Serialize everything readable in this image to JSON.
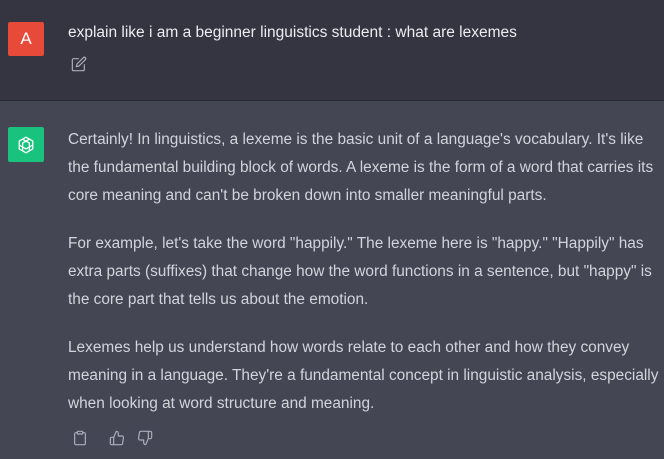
{
  "user_message": {
    "avatar_letter": "A",
    "avatar_color": "#e84a3a",
    "text": "explain like i am a beginner linguistics student : what are lexemes",
    "edit_icon": "edit-icon"
  },
  "assistant_message": {
    "avatar_icon": "openai-logo-icon",
    "avatar_color": "#19c37d",
    "paragraphs": [
      "Certainly! In linguistics, a lexeme is the basic unit of a language's vocabulary. It's like the fundamental building block of words. A lexeme is the form of a word that carries its core meaning and can't be broken down into smaller meaningful parts.",
      "For example, let's take the word \"happily.\" The lexeme here is \"happy.\" \"Happily\" has extra parts (suffixes) that change how the word functions in a sentence, but \"happy\" is the core part that tells us about the emotion.",
      "Lexemes help us understand how words relate to each other and how they convey meaning in a language. They're a fundamental concept in linguistic analysis, especially when looking at word structure and meaning."
    ],
    "actions": [
      "copy-icon",
      "thumbs-up-icon",
      "thumbs-down-icon"
    ]
  },
  "colors": {
    "user_bg": "#343541",
    "assistant_bg": "#444654",
    "text": "#d1d5db",
    "icon": "#acacbe"
  }
}
